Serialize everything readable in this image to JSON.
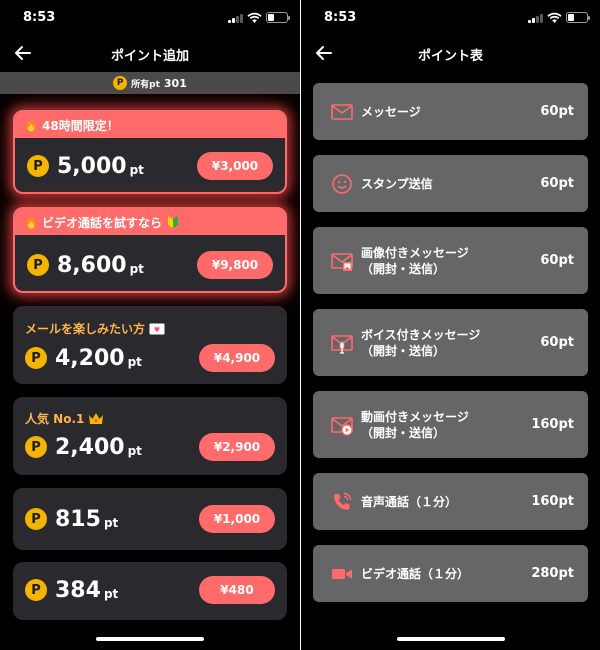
{
  "time": "8:53",
  "left": {
    "title": "ポイント追加",
    "balance_label": "所有pt",
    "balance_value": "301",
    "offers": [
      {
        "banner": "48時間限定！",
        "amount": "5,000",
        "unit": "pt",
        "price": "¥3,000"
      },
      {
        "banner": "ビデオ通話を試すなら",
        "amount": "8,600",
        "unit": "pt",
        "price": "¥9,800"
      },
      {
        "tag": "メールを楽しみたい方",
        "amount": "4,200",
        "unit": "pt",
        "price": "¥4,900"
      },
      {
        "tag": "人気 No.1",
        "amount": "2,400",
        "unit": "pt",
        "price": "¥2,900"
      },
      {
        "amount": "815",
        "unit": "pt",
        "price": "¥1,000"
      },
      {
        "amount": "384",
        "unit": "pt",
        "price": "¥480"
      }
    ],
    "coin_symbol": "P"
  },
  "right": {
    "title": "ポイント表",
    "items": [
      {
        "icon": "envelope-icon",
        "label": "メッセージ",
        "value": "60pt"
      },
      {
        "icon": "smiley-icon",
        "label": "スタンプ送信",
        "value": "60pt"
      },
      {
        "icon": "image-mail-icon",
        "label": "画像付きメッセージ",
        "sub": "（開封・送信）",
        "value": "60pt"
      },
      {
        "icon": "voice-mail-icon",
        "label": "ボイス付きメッセージ",
        "sub": "（開封・送信）",
        "value": "60pt"
      },
      {
        "icon": "video-mail-icon",
        "label": "動画付きメッセージ",
        "sub": "（開封・送信）",
        "value": "160pt"
      },
      {
        "icon": "phone-icon",
        "label": "音声通話（１分）",
        "value": "160pt"
      },
      {
        "icon": "video-camera-icon",
        "label": "ビデオ通話（１分）",
        "value": "280pt"
      }
    ]
  },
  "colors": {
    "accent": "#ff6b6b",
    "coin": "#f5b400",
    "tag": "#ffb547",
    "card": "#2a2a2e",
    "item": "#666669"
  }
}
